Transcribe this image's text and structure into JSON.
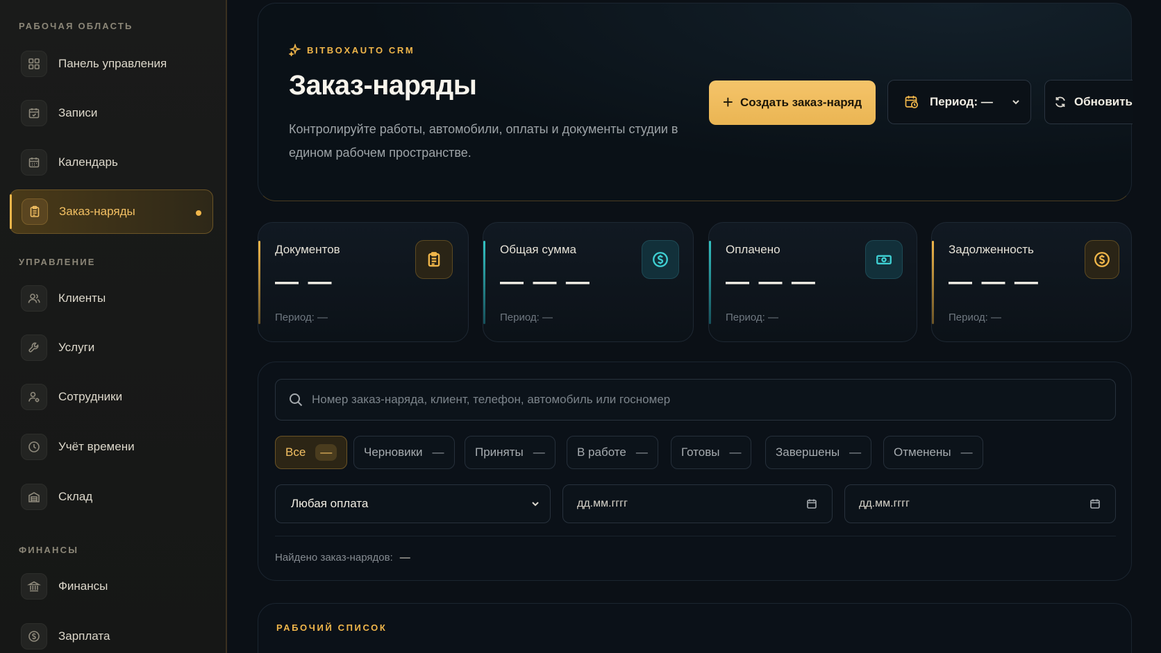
{
  "sidebar": {
    "sections": [
      "РАБОЧАЯ ОБЛАСТЬ",
      "УПРАВЛЕНИЕ",
      "ФИНАНСЫ"
    ],
    "items": [
      {
        "label": "Панель управления",
        "icon": "grid-icon"
      },
      {
        "label": "Записи",
        "icon": "calendar-check-icon"
      },
      {
        "label": "Календарь",
        "icon": "calendar-icon"
      },
      {
        "label": "Заказ-наряды",
        "icon": "clipboard-icon",
        "active": true
      },
      {
        "label": "Клиенты",
        "icon": "users-icon"
      },
      {
        "label": "Услуги",
        "icon": "wrench-icon"
      },
      {
        "label": "Сотрудники",
        "icon": "user-gear-icon"
      },
      {
        "label": "Учёт времени",
        "icon": "clock-icon"
      },
      {
        "label": "Склад",
        "icon": "warehouse-icon"
      },
      {
        "label": "Финансы",
        "icon": "bank-icon"
      },
      {
        "label": "Зарплата",
        "icon": "coin-icon"
      }
    ]
  },
  "header": {
    "brand": "BITBOXAUTO CRM",
    "title": "Заказ-наряды",
    "subtitle": "Контролируйте работы, автомобили, оплаты и документы студии в едином рабочем пространстве.",
    "create_label": "Создать заказ-наряд",
    "period_label": "Период: —",
    "refresh_label": "Обновить"
  },
  "stats": [
    {
      "label": "Документов",
      "value": "— —",
      "note": "Период: —",
      "accent": "#f0b64a",
      "icon": "clipboard-icon"
    },
    {
      "label": "Общая сумма",
      "value": "— — —",
      "note": "Период: —",
      "accent": "#33c2c2",
      "icon": "dollar-circle-icon"
    },
    {
      "label": "Оплачено",
      "value": "— — —",
      "note": "Период: —",
      "accent": "#33c2c2",
      "icon": "banknote-icon"
    },
    {
      "label": "Задолженность",
      "value": "— — —",
      "note": "Период: —",
      "accent": "#f0b64a",
      "icon": "dollar-circle-icon"
    }
  ],
  "filters": {
    "search_placeholder": "Номер заказ-наряда, клиент, телефон, автомобиль или госномер",
    "chips": [
      {
        "label": "Все",
        "count": "—",
        "active": true
      },
      {
        "label": "Черновики",
        "count": "—"
      },
      {
        "label": "Приняты",
        "count": "—"
      },
      {
        "label": "В работе",
        "count": "—"
      },
      {
        "label": "Готовы",
        "count": "—"
      },
      {
        "label": "Завершены",
        "count": "—"
      },
      {
        "label": "Отменены",
        "count": "—"
      }
    ],
    "payment_select": "Любая оплата",
    "date_from": "дд.мм.гггг",
    "date_to": "дд.мм.гггг",
    "found_label": "Найдено заказ-нарядов:",
    "found_value": "—"
  },
  "worklist": {
    "title": "РАБОЧИЙ СПИСОК"
  },
  "colors": {
    "accent_gold": "#f0b64a",
    "accent_teal": "#33c2c2",
    "background": "#0b1016"
  }
}
